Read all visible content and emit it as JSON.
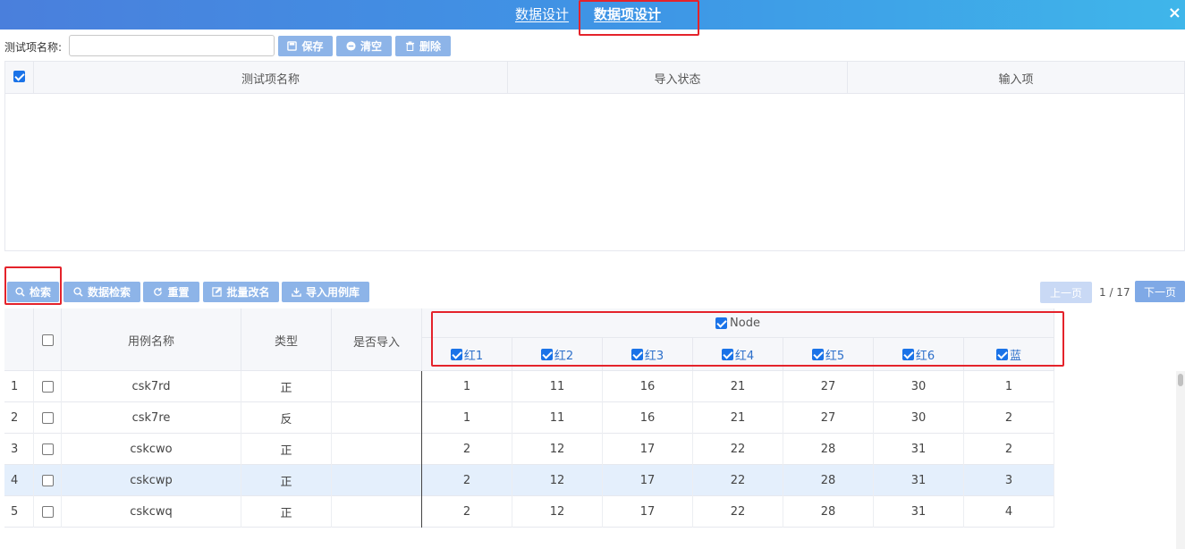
{
  "header": {
    "tabs": [
      {
        "label": "数据设计",
        "active": false
      },
      {
        "label": "数据项设计",
        "active": true
      }
    ],
    "close_glyph": "×"
  },
  "form": {
    "name_label": "测试项名称:",
    "name_value": "",
    "buttons": {
      "save": "保存",
      "clear": "清空",
      "delete": "删除"
    }
  },
  "top_table": {
    "columns": [
      "测试项名称",
      "导入状态",
      "输入项"
    ],
    "select_all_checked": true
  },
  "toolbar": {
    "buttons": {
      "search": "检索",
      "data_search": "数据检索",
      "reset": "重置",
      "batch_rename": "批量改名",
      "import": "导入用例库"
    }
  },
  "pagination": {
    "prev": "上一页",
    "next": "下一页",
    "current": 1,
    "total": 17,
    "info": "1 / 17"
  },
  "grid": {
    "columns": {
      "name": "用例名称",
      "type": "类型",
      "imported": "是否导入"
    },
    "group": {
      "label": "Node",
      "checked": true
    },
    "sub_columns": [
      {
        "label": "红1",
        "checked": true
      },
      {
        "label": "红2",
        "checked": true
      },
      {
        "label": "红3",
        "checked": true
      },
      {
        "label": "红4",
        "checked": true
      },
      {
        "label": "红5",
        "checked": true
      },
      {
        "label": "红6",
        "checked": true
      },
      {
        "label": "蓝",
        "checked": true
      }
    ],
    "rows": [
      {
        "index": "1",
        "name": "csk7rd",
        "type": "正",
        "imported": "",
        "values": [
          "1",
          "11",
          "16",
          "21",
          "27",
          "30",
          "1"
        ],
        "highlighted": false
      },
      {
        "index": "2",
        "name": "csk7re",
        "type": "反",
        "imported": "",
        "values": [
          "1",
          "11",
          "16",
          "21",
          "27",
          "30",
          "2"
        ],
        "highlighted": false
      },
      {
        "index": "3",
        "name": "cskcwo",
        "type": "正",
        "imported": "",
        "values": [
          "2",
          "12",
          "17",
          "22",
          "28",
          "31",
          "2"
        ],
        "highlighted": false
      },
      {
        "index": "4",
        "name": "cskcwp",
        "type": "正",
        "imported": "",
        "values": [
          "2",
          "12",
          "17",
          "22",
          "28",
          "31",
          "3"
        ],
        "highlighted": true
      },
      {
        "index": "5",
        "name": "cskcwq",
        "type": "正",
        "imported": "",
        "values": [
          "2",
          "12",
          "17",
          "22",
          "28",
          "31",
          "4"
        ],
        "highlighted": false
      }
    ]
  },
  "colors": {
    "header_start": "#4a7fdc",
    "header_end": "#3fb6ea",
    "button": "#8db4e8",
    "highlight_row": "#e4effc",
    "annotation": "#e4232b",
    "checkbox": "#1a73e8"
  }
}
